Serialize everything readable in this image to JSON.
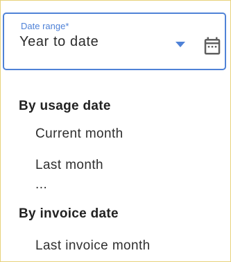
{
  "date_field": {
    "label": "Date range*",
    "value": "Year to date",
    "accent_color": "#4f82d7",
    "dropdown_icon": "chevron-down-icon",
    "calendar_icon": "calendar-icon"
  },
  "menu": {
    "groups": [
      {
        "header": "By usage date",
        "items": [
          "Current month",
          "Last month"
        ],
        "ellipsis": "..."
      },
      {
        "header": "By invoice date",
        "items": [
          "Last invoice month"
        ]
      }
    ]
  }
}
